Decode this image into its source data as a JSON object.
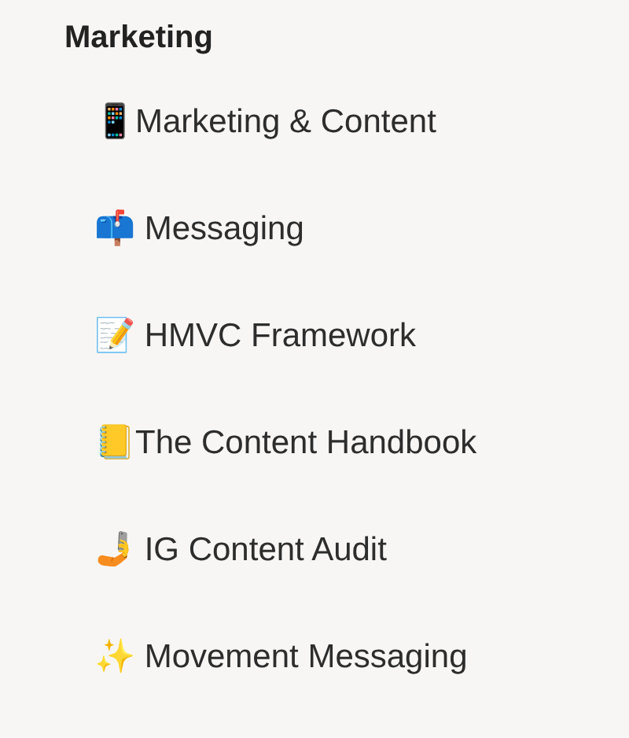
{
  "section": {
    "title": "Marketing"
  },
  "items": [
    {
      "label": "📱Marketing & Content"
    },
    {
      "label": "📫 Messaging"
    },
    {
      "label": "📝 HMVC Framework"
    },
    {
      "label": "📒The Content Handbook"
    },
    {
      "label": "🤳 IG Content Audit"
    },
    {
      "label": "✨ Movement Messaging"
    }
  ]
}
